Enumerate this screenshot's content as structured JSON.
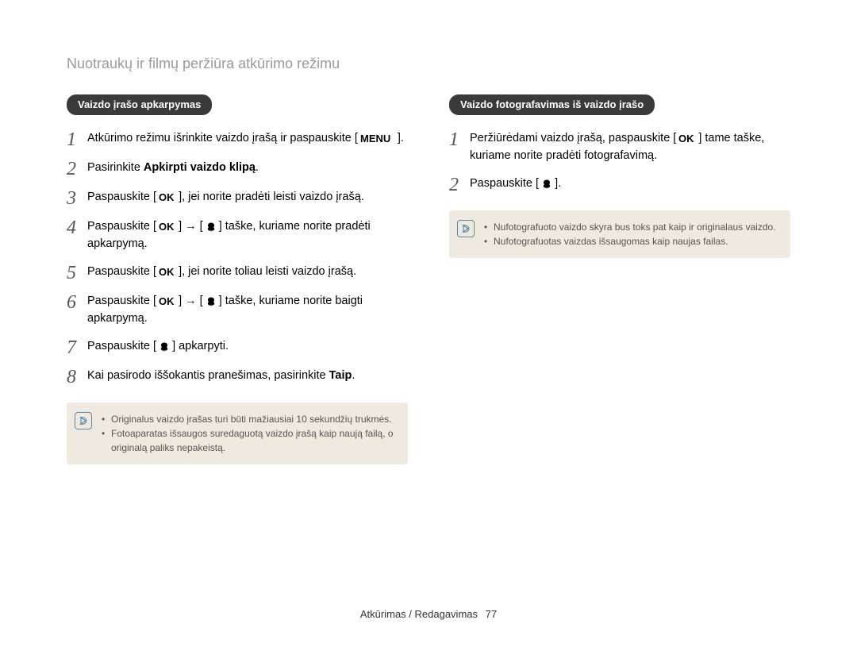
{
  "page_title": "Nuotraukų ir filmų peržiūra atkūrimo režimu",
  "left": {
    "heading": "Vaizdo įrašo apkarpymas",
    "steps": [
      {
        "n": "1",
        "parts": [
          {
            "t": "Atkūrimo režimu išrinkite vaizdo įrašą ir paspauskite ["
          },
          {
            "key": "MENU"
          },
          {
            "t": "]."
          }
        ]
      },
      {
        "n": "2",
        "parts": [
          {
            "t": "Pasirinkite "
          },
          {
            "bold": "Apkirpti vaizdo klipą"
          },
          {
            "t": "."
          }
        ]
      },
      {
        "n": "3",
        "parts": [
          {
            "t": "Paspauskite ["
          },
          {
            "key": "OK"
          },
          {
            "t": "], jei norite pradėti leisti vaizdo įrašą."
          }
        ]
      },
      {
        "n": "4",
        "parts": [
          {
            "t": "Paspauskite ["
          },
          {
            "key": "OK"
          },
          {
            "t": "] → ["
          },
          {
            "key": "DOWN"
          },
          {
            "t": "] taške, kuriame norite pradėti apkarpymą."
          }
        ]
      },
      {
        "n": "5",
        "parts": [
          {
            "t": "Paspauskite ["
          },
          {
            "key": "OK"
          },
          {
            "t": "], jei norite toliau leisti vaizdo įrašą."
          }
        ]
      },
      {
        "n": "6",
        "parts": [
          {
            "t": "Paspauskite ["
          },
          {
            "key": "OK"
          },
          {
            "t": "] → ["
          },
          {
            "key": "DOWN"
          },
          {
            "t": "] taške, kuriame norite baigti apkarpymą."
          }
        ]
      },
      {
        "n": "7",
        "parts": [
          {
            "t": "Paspauskite ["
          },
          {
            "key": "DOWN"
          },
          {
            "t": "] apkarpyti."
          }
        ]
      },
      {
        "n": "8",
        "parts": [
          {
            "t": "Kai pasirodo iššokantis pranešimas, pasirinkite "
          },
          {
            "bold": "Taip"
          },
          {
            "t": "."
          }
        ]
      }
    ],
    "notes": [
      "Originalus vaizdo įrašas turi būti mažiausiai 10 sekundžių trukmės.",
      "Fotoaparatas išsaugos suredaguotą vaizdo įrašą kaip naują failą, o originalą paliks nepakeistą."
    ]
  },
  "right": {
    "heading": "Vaizdo fotografavimas iš vaizdo įrašo",
    "steps": [
      {
        "n": "1",
        "parts": [
          {
            "t": "Peržiūrėdami vaizdo įrašą, paspauskite ["
          },
          {
            "key": "OK"
          },
          {
            "t": "] tame taške, kuriame norite pradėti fotografavimą."
          }
        ]
      },
      {
        "n": "2",
        "parts": [
          {
            "t": "Paspauskite ["
          },
          {
            "key": "DOWN"
          },
          {
            "t": "]."
          }
        ]
      }
    ],
    "notes": [
      "Nufotografuoto vaizdo skyra bus toks pat kaip ir originalaus vaizdo.",
      "Nufotografuotas vaizdas išsaugomas kaip naujas failas."
    ]
  },
  "footer": {
    "section": "Atkūrimas / Redagavimas",
    "page": "77"
  },
  "icons": {
    "OK": "ok",
    "MENU": "menu",
    "DOWN": "down"
  }
}
